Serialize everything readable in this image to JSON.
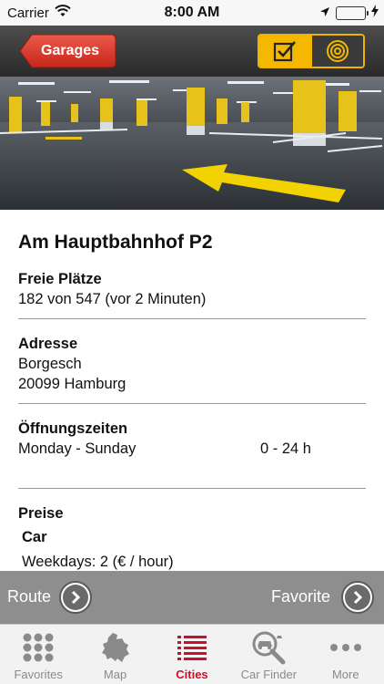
{
  "status_bar": {
    "carrier": "Carrier",
    "time": "8:00 AM",
    "icons": [
      "wifi-icon",
      "location-arrow-icon",
      "battery-icon",
      "charging-bolt-icon"
    ]
  },
  "nav": {
    "back_label": "Garages",
    "segments": [
      {
        "icon": "checklist-icon",
        "active": true
      },
      {
        "icon": "target-icon",
        "active": false
      }
    ],
    "colors": {
      "back_button": "#d9342b",
      "segment_accent": "#f5b800",
      "bar": "#3a3a3a"
    }
  },
  "garage": {
    "name": "Am Hauptbahnhof P2",
    "free_spaces": {
      "label": "Freie Plätze",
      "value": "182 von 547 (vor 2 Minuten)"
    },
    "address": {
      "label": "Adresse",
      "street": "Borgesch",
      "city": "20099 Hamburg"
    },
    "opening_hours": {
      "label": "Öffnungszeiten",
      "days": "Monday - Sunday",
      "hours": "0 - 24 h"
    },
    "prices": {
      "label": "Preise",
      "category": "Car",
      "weekdays": "Weekdays: 2 (€ / hour)"
    }
  },
  "actions": {
    "route_label": "Route",
    "favorite_label": "Favorite"
  },
  "tabs": [
    {
      "label": "Favorites",
      "icon": "grid-dots-icon",
      "active": false
    },
    {
      "label": "Map",
      "icon": "europe-map-icon",
      "active": false
    },
    {
      "label": "Cities",
      "icon": "list-icon",
      "active": true
    },
    {
      "label": "Car Finder",
      "icon": "car-search-icon",
      "active": false
    },
    {
      "label": "More",
      "icon": "more-dots-icon",
      "active": false
    }
  ],
  "colors": {
    "tab_active": "#c8102e",
    "action_bar": "#8e8e8e"
  }
}
